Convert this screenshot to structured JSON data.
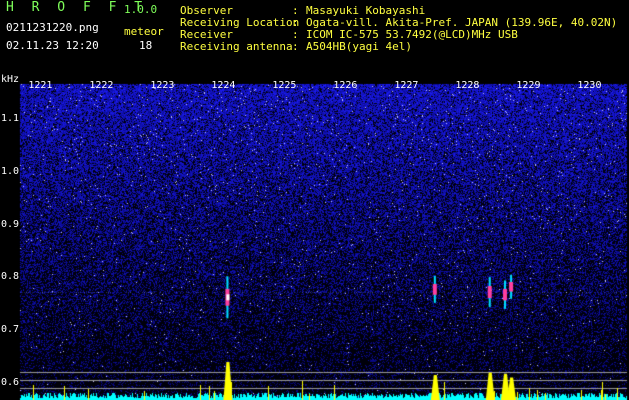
{
  "header": {
    "app_title": "H R O F F T",
    "version": "1.0.0",
    "filename": "0211231220.png",
    "datetime": "02.11.23 12:20",
    "event_label": "meteor",
    "event_count": "18",
    "fields": [
      {
        "label": "Observer",
        "sep": ":",
        "value": "Masayuki Kobayashi"
      },
      {
        "label": "Receiving Location",
        "sep": ":",
        "value": "Ogata-vill. Akita-Pref. JAPAN (139.96E, 40.02N)"
      },
      {
        "label": "Receiver",
        "sep": ":",
        "value": "ICOM IC-575 53.7492(@LCD)MHz USB"
      },
      {
        "label": "Receiving antenna",
        "sep": ":",
        "value": "A504HB(yagi 4el)"
      }
    ]
  },
  "axes": {
    "y_unit": "kHz",
    "y_ticks": [
      "1.1",
      "1.0",
      "0.9",
      "0.8",
      "0.7",
      "0.6"
    ],
    "x_ticks": [
      "1221",
      "1222",
      "1223",
      "1224",
      "1225",
      "1226",
      "1227",
      "1228",
      "1229",
      "1230"
    ]
  },
  "colors": {
    "background": "#000000",
    "header_green": "#7fff5a",
    "header_yellow": "#ffff40",
    "noise_blue": "#2a2fd0",
    "meteor_magenta": "#ff3fa0",
    "meteor_cyan": "#00e0ff",
    "signal_yellow": "#ffff00",
    "baseline_cyan": "#00ffff"
  },
  "meteor_events": [
    {
      "minute": 1224.05,
      "freq_khz": 0.76,
      "strength": 1.0
    },
    {
      "minute": 1227.45,
      "freq_khz": 0.775,
      "strength": 0.5
    },
    {
      "minute": 1228.35,
      "freq_khz": 0.77,
      "strength": 0.6
    },
    {
      "minute": 1228.6,
      "freq_khz": 0.765,
      "strength": 0.55
    },
    {
      "minute": 1228.7,
      "freq_khz": 0.78,
      "strength": 0.4
    }
  ]
}
